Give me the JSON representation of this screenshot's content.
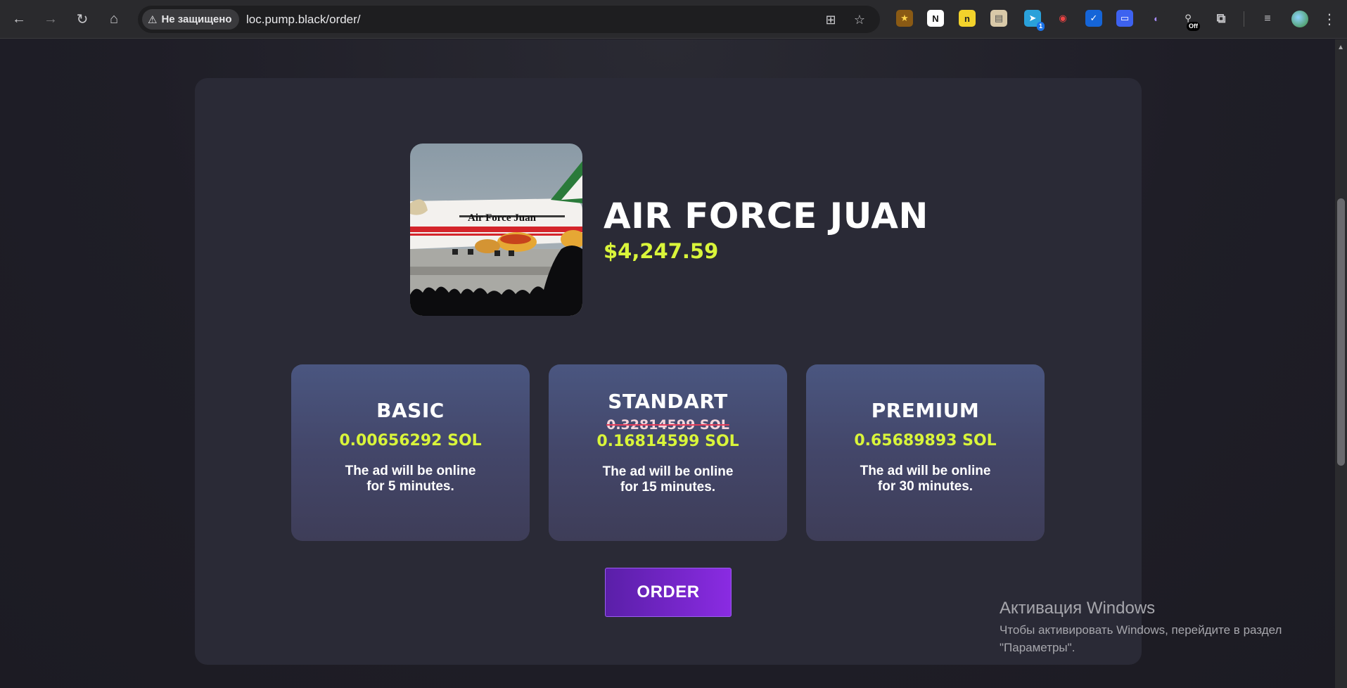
{
  "browser": {
    "security_label": "Не защищено",
    "url": "loc.pump.black/order/",
    "extensions": [
      {
        "name": "bookmark-ext-icon",
        "bg": "#8a5a14",
        "fg": "#ffd54a",
        "glyph": "★"
      },
      {
        "name": "notion-icon",
        "bg": "#ffffff",
        "fg": "#111111",
        "glyph": "N"
      },
      {
        "name": "ext-yellow-icon",
        "bg": "#f2d22b",
        "fg": "#222",
        "glyph": "n"
      },
      {
        "name": "clipboard-icon",
        "bg": "#d9c9a8",
        "fg": "#555",
        "glyph": "▤"
      },
      {
        "name": "telegram-icon",
        "bg": "#2aa1da",
        "fg": "#fff",
        "glyph": "➤",
        "badge": "1"
      },
      {
        "name": "ext-shield-icon",
        "bg": "#2a2a2d",
        "fg": "#e44",
        "glyph": "◉"
      },
      {
        "name": "checkmark-icon",
        "bg": "#1565d8",
        "fg": "#fff",
        "glyph": "✓"
      },
      {
        "name": "keyboard-ext-icon",
        "bg": "#3d62f0",
        "fg": "#fff",
        "glyph": "▭"
      },
      {
        "name": "ghost-ext-icon",
        "bg": "#2a2a2d",
        "fg": "#a78bfa",
        "glyph": "◐"
      },
      {
        "name": "lock-off-icon",
        "bg": "#2a2a2d",
        "fg": "#ddd",
        "glyph": "⚲",
        "badge_dark": "Off"
      }
    ]
  },
  "token": {
    "name": "AIR FORCE JUAN",
    "price": "$4,247.59",
    "image_alt": "Air Force Juan"
  },
  "plans": [
    {
      "title": "BASIC",
      "old_price": "",
      "price": "0.00656292 SOL",
      "desc_line1": "The ad will be online",
      "desc_prefix": "for ",
      "duration": "5 minutes",
      "desc_suffix": "."
    },
    {
      "title": "STANDART",
      "old_price": "0.32814599 SOL",
      "price": "0.16814599 SOL",
      "desc_line1": "The ad will be online",
      "desc_prefix": "for ",
      "duration": "15 minutes",
      "desc_suffix": "."
    },
    {
      "title": "PREMIUM",
      "old_price": "",
      "price": "0.65689893 SOL",
      "desc_line1": "The ad will be online",
      "desc_prefix": "for ",
      "duration": "30 minutes",
      "desc_suffix": "."
    }
  ],
  "order_button": "ORDER",
  "windows_activation": {
    "title": "Активация Windows",
    "line1": "Чтобы активировать Windows, перейдите в раздел",
    "line2": "\"Параметры\"."
  },
  "colors": {
    "accent_price": "#d9f53a",
    "order_button": "#8a2be2",
    "card_bg": "#2a2a36"
  }
}
